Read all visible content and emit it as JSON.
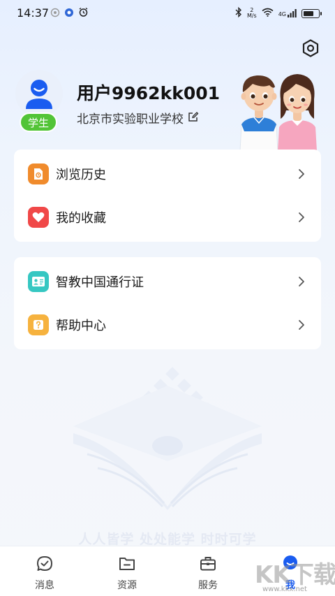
{
  "status_bar": {
    "time": "14:37",
    "net_speed_top": "2",
    "net_speed_bottom": "M/s",
    "network": "4G",
    "battery_level": 0.75
  },
  "profile": {
    "username": "用户9962kk001",
    "school": "北京市实验职业学校",
    "role_badge": "学生",
    "accent_color": "#1a5cf0",
    "badge_color": "#52c437"
  },
  "menu_group_1": [
    {
      "label": "浏览历史",
      "icon": "document-icon",
      "color": "#f08b2c"
    },
    {
      "label": "我的收藏",
      "icon": "heart-icon",
      "color": "#f04848"
    }
  ],
  "menu_group_2": [
    {
      "label": "智教中国通行证",
      "icon": "id-card-icon",
      "color": "#36c7c2"
    },
    {
      "label": "帮助中心",
      "icon": "question-icon",
      "color": "#f6b23e"
    }
  ],
  "slogan": "人人皆学  处处能学   时时可学",
  "tab_bar": {
    "tabs": [
      {
        "label": "消息",
        "icon": "message-icon",
        "active": false
      },
      {
        "label": "资源",
        "icon": "folder-icon",
        "active": false
      },
      {
        "label": "服务",
        "icon": "briefcase-icon",
        "active": false
      },
      {
        "label": "我",
        "icon": "me-icon",
        "active": true
      }
    ]
  },
  "watermark": {
    "text": "KK下载",
    "url": "www.kkx.net"
  }
}
